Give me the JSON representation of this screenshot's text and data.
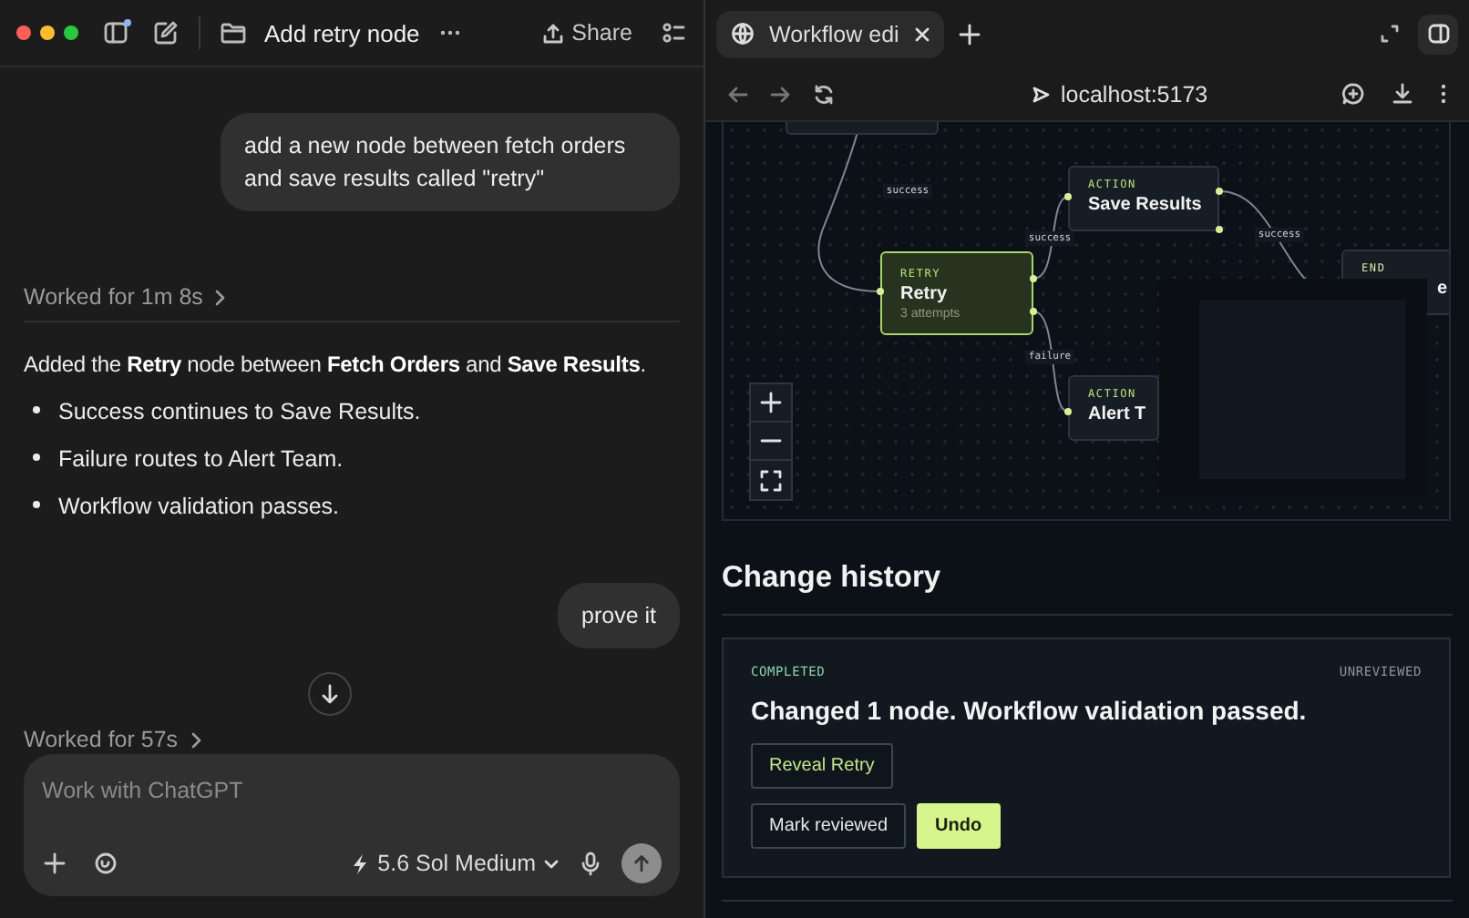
{
  "chat": {
    "toolbar": {
      "title": "Add retry node",
      "share": "Share"
    },
    "messages": [
      {
        "kind": "user",
        "text": "add a new node between fetch orders and save results called \"retry\""
      },
      {
        "kind": "worked",
        "text": "Worked for 1m 8s"
      },
      {
        "kind": "assistant",
        "text": "Added the **Retry** node between **Fetch Orders** and **Save Results**.",
        "bullets": [
          "Success continues to Save Results.",
          "Failure routes to Alert Team.",
          "Workflow validation passes."
        ]
      },
      {
        "kind": "user",
        "text": "prove it"
      },
      {
        "kind": "worked",
        "text": "Worked for 57s"
      }
    ],
    "composer": {
      "placeholder": "Work with ChatGPT",
      "model": "5.6 Sol Medium"
    }
  },
  "browser": {
    "tabs": [
      {
        "title": "Workflow edi",
        "selected": true
      }
    ],
    "url": "localhost:5173"
  },
  "workflow": {
    "nodes": [
      {
        "kind": "action",
        "selected": false
      },
      {
        "kind": "action",
        "type": "ACTION",
        "label": "Save Results",
        "selected": false
      },
      {
        "kind": "retry",
        "type": "RETRY",
        "label": "Retry",
        "subtitle": "3 attempts",
        "selected": true
      },
      {
        "kind": "action",
        "type": "ACTION",
        "label": "Alert T",
        "selected": false
      },
      {
        "kind": "end",
        "type": "END",
        "label": "e",
        "selected": false
      }
    ],
    "edges": [
      {
        "label": "success"
      },
      {
        "label": "success"
      },
      {
        "label": "success"
      },
      {
        "label": "failure"
      }
    ]
  },
  "history": {
    "title": "Change history",
    "entries": [
      {
        "status": "COMPLETED",
        "review": "UNREVIEWED",
        "summary": "Changed 1 node. Workflow validation passed.",
        "actions": [
          {
            "label": "Reveal Retry",
            "kind": "outline"
          },
          {
            "label": "Mark reviewed",
            "kind": "secondary"
          },
          {
            "label": "Undo",
            "kind": "primary"
          }
        ]
      }
    ]
  }
}
